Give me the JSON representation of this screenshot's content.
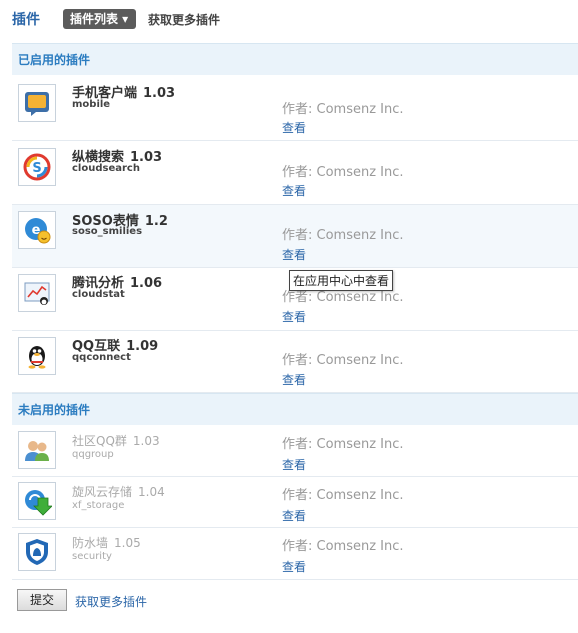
{
  "header": {
    "title": "插件",
    "list_button": "插件列表 ▾",
    "more_link": "获取更多插件"
  },
  "enabled_section": {
    "title": "已启用的插件"
  },
  "disabled_section": {
    "title": "未启用的插件"
  },
  "enabled_plugins": [
    {
      "name": "手机客户端",
      "version": "1.03",
      "id": "mobile",
      "author": "作者: Comsenz Inc.",
      "view": "查看",
      "icon": "mobile-chat-icon"
    },
    {
      "name": "纵横搜索",
      "version": "1.03",
      "id": "cloudsearch",
      "author": "作者: Comsenz Inc.",
      "view": "查看",
      "icon": "cloudsearch-icon"
    },
    {
      "name": "SOSO表情",
      "version": "1.2",
      "id": "soso_smilies",
      "author": "作者: Comsenz Inc.",
      "view": "查看",
      "icon": "soso-smiley-icon"
    },
    {
      "name": "腾讯分析",
      "version": "1.06",
      "id": "cloudstat",
      "author": "作者: Comsenz Inc.",
      "view": "查看",
      "icon": "analytics-icon"
    },
    {
      "name": "QQ互联",
      "version": "1.09",
      "id": "qqconnect",
      "author": "作者: Comsenz Inc.",
      "view": "查看",
      "icon": "qq-penguin-icon"
    }
  ],
  "disabled_plugins": [
    {
      "name": "社区QQ群",
      "version": "1.03",
      "id": "qqgroup",
      "author": "作者: Comsenz Inc.",
      "view": "查看",
      "icon": "qq-group-icon"
    },
    {
      "name": "旋风云存储",
      "version": "1.04",
      "id": "xf_storage",
      "author": "作者: Comsenz Inc.",
      "view": "查看",
      "icon": "cloud-storage-icon"
    },
    {
      "name": "防水墙",
      "version": "1.05",
      "id": "security",
      "author": "作者: Comsenz Inc.",
      "view": "查看",
      "icon": "security-shield-icon"
    }
  ],
  "tooltip": "在应用中心中查看",
  "footer": {
    "submit": "提交",
    "more_link": "获取更多插件"
  }
}
